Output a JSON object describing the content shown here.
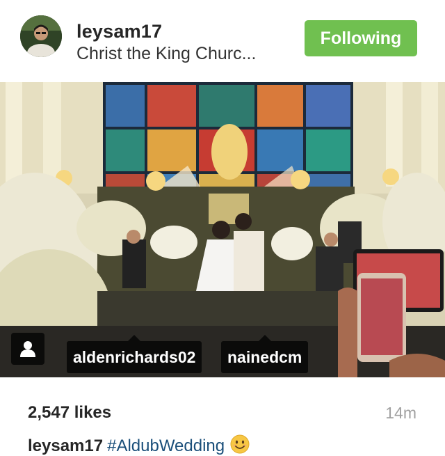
{
  "header": {
    "username": "leysam17",
    "location": "Christ the King Churc...",
    "follow_label": "Following",
    "follow_color": "#70c050"
  },
  "photo": {
    "tags": [
      {
        "label": "aldenrichards02"
      },
      {
        "label": "nainedcm"
      }
    ],
    "tag_icon": "person-icon"
  },
  "footer": {
    "likes": "2,547 likes",
    "timestamp": "14m",
    "caption_user": "leysam17",
    "caption_hashtag": "#AldubWedding",
    "caption_emoji": "smiling-face-icon"
  }
}
